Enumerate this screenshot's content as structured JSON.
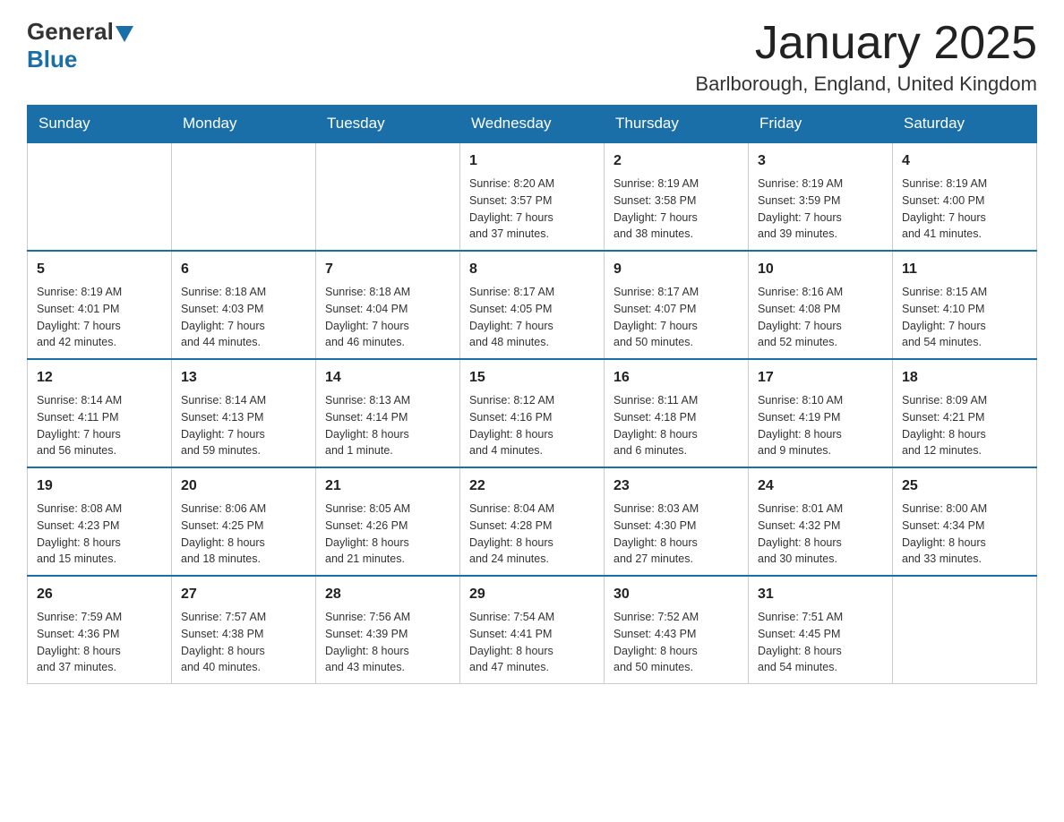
{
  "header": {
    "logo_general": "General",
    "logo_blue": "Blue",
    "title": "January 2025",
    "subtitle": "Barlborough, England, United Kingdom"
  },
  "weekdays": [
    "Sunday",
    "Monday",
    "Tuesday",
    "Wednesday",
    "Thursday",
    "Friday",
    "Saturday"
  ],
  "weeks": [
    [
      {
        "day": "",
        "info": ""
      },
      {
        "day": "",
        "info": ""
      },
      {
        "day": "",
        "info": ""
      },
      {
        "day": "1",
        "info": "Sunrise: 8:20 AM\nSunset: 3:57 PM\nDaylight: 7 hours\nand 37 minutes."
      },
      {
        "day": "2",
        "info": "Sunrise: 8:19 AM\nSunset: 3:58 PM\nDaylight: 7 hours\nand 38 minutes."
      },
      {
        "day": "3",
        "info": "Sunrise: 8:19 AM\nSunset: 3:59 PM\nDaylight: 7 hours\nand 39 minutes."
      },
      {
        "day": "4",
        "info": "Sunrise: 8:19 AM\nSunset: 4:00 PM\nDaylight: 7 hours\nand 41 minutes."
      }
    ],
    [
      {
        "day": "5",
        "info": "Sunrise: 8:19 AM\nSunset: 4:01 PM\nDaylight: 7 hours\nand 42 minutes."
      },
      {
        "day": "6",
        "info": "Sunrise: 8:18 AM\nSunset: 4:03 PM\nDaylight: 7 hours\nand 44 minutes."
      },
      {
        "day": "7",
        "info": "Sunrise: 8:18 AM\nSunset: 4:04 PM\nDaylight: 7 hours\nand 46 minutes."
      },
      {
        "day": "8",
        "info": "Sunrise: 8:17 AM\nSunset: 4:05 PM\nDaylight: 7 hours\nand 48 minutes."
      },
      {
        "day": "9",
        "info": "Sunrise: 8:17 AM\nSunset: 4:07 PM\nDaylight: 7 hours\nand 50 minutes."
      },
      {
        "day": "10",
        "info": "Sunrise: 8:16 AM\nSunset: 4:08 PM\nDaylight: 7 hours\nand 52 minutes."
      },
      {
        "day": "11",
        "info": "Sunrise: 8:15 AM\nSunset: 4:10 PM\nDaylight: 7 hours\nand 54 minutes."
      }
    ],
    [
      {
        "day": "12",
        "info": "Sunrise: 8:14 AM\nSunset: 4:11 PM\nDaylight: 7 hours\nand 56 minutes."
      },
      {
        "day": "13",
        "info": "Sunrise: 8:14 AM\nSunset: 4:13 PM\nDaylight: 7 hours\nand 59 minutes."
      },
      {
        "day": "14",
        "info": "Sunrise: 8:13 AM\nSunset: 4:14 PM\nDaylight: 8 hours\nand 1 minute."
      },
      {
        "day": "15",
        "info": "Sunrise: 8:12 AM\nSunset: 4:16 PM\nDaylight: 8 hours\nand 4 minutes."
      },
      {
        "day": "16",
        "info": "Sunrise: 8:11 AM\nSunset: 4:18 PM\nDaylight: 8 hours\nand 6 minutes."
      },
      {
        "day": "17",
        "info": "Sunrise: 8:10 AM\nSunset: 4:19 PM\nDaylight: 8 hours\nand 9 minutes."
      },
      {
        "day": "18",
        "info": "Sunrise: 8:09 AM\nSunset: 4:21 PM\nDaylight: 8 hours\nand 12 minutes."
      }
    ],
    [
      {
        "day": "19",
        "info": "Sunrise: 8:08 AM\nSunset: 4:23 PM\nDaylight: 8 hours\nand 15 minutes."
      },
      {
        "day": "20",
        "info": "Sunrise: 8:06 AM\nSunset: 4:25 PM\nDaylight: 8 hours\nand 18 minutes."
      },
      {
        "day": "21",
        "info": "Sunrise: 8:05 AM\nSunset: 4:26 PM\nDaylight: 8 hours\nand 21 minutes."
      },
      {
        "day": "22",
        "info": "Sunrise: 8:04 AM\nSunset: 4:28 PM\nDaylight: 8 hours\nand 24 minutes."
      },
      {
        "day": "23",
        "info": "Sunrise: 8:03 AM\nSunset: 4:30 PM\nDaylight: 8 hours\nand 27 minutes."
      },
      {
        "day": "24",
        "info": "Sunrise: 8:01 AM\nSunset: 4:32 PM\nDaylight: 8 hours\nand 30 minutes."
      },
      {
        "day": "25",
        "info": "Sunrise: 8:00 AM\nSunset: 4:34 PM\nDaylight: 8 hours\nand 33 minutes."
      }
    ],
    [
      {
        "day": "26",
        "info": "Sunrise: 7:59 AM\nSunset: 4:36 PM\nDaylight: 8 hours\nand 37 minutes."
      },
      {
        "day": "27",
        "info": "Sunrise: 7:57 AM\nSunset: 4:38 PM\nDaylight: 8 hours\nand 40 minutes."
      },
      {
        "day": "28",
        "info": "Sunrise: 7:56 AM\nSunset: 4:39 PM\nDaylight: 8 hours\nand 43 minutes."
      },
      {
        "day": "29",
        "info": "Sunrise: 7:54 AM\nSunset: 4:41 PM\nDaylight: 8 hours\nand 47 minutes."
      },
      {
        "day": "30",
        "info": "Sunrise: 7:52 AM\nSunset: 4:43 PM\nDaylight: 8 hours\nand 50 minutes."
      },
      {
        "day": "31",
        "info": "Sunrise: 7:51 AM\nSunset: 4:45 PM\nDaylight: 8 hours\nand 54 minutes."
      },
      {
        "day": "",
        "info": ""
      }
    ]
  ]
}
